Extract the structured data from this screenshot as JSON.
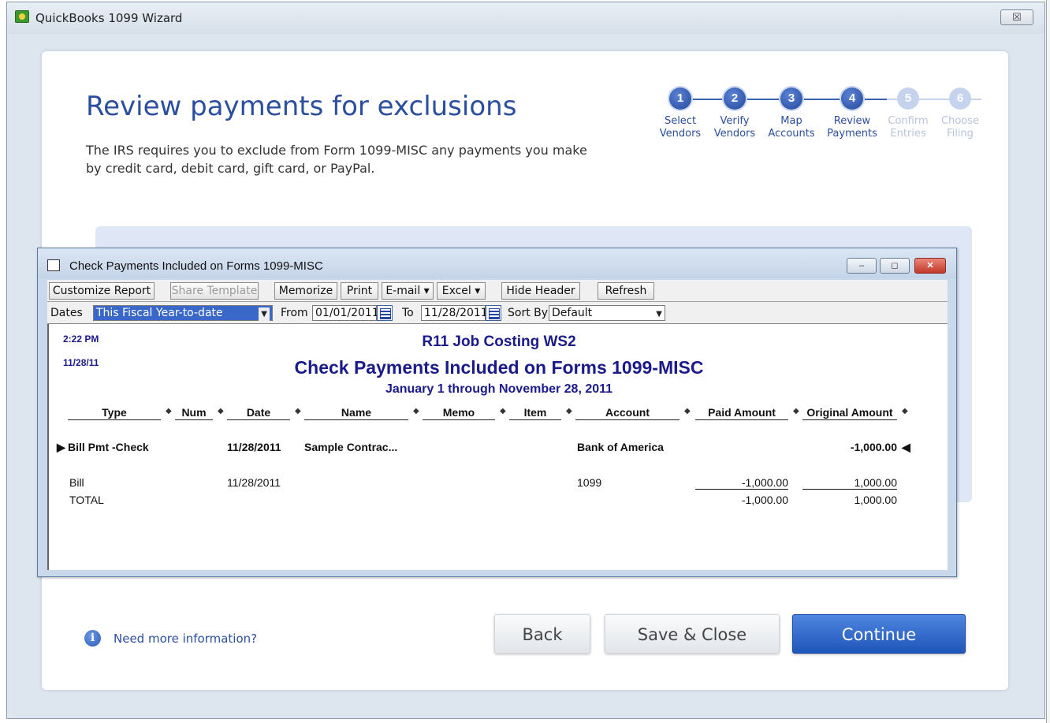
{
  "window": {
    "title": "QuickBooks 1099 Wizard",
    "close_glyph": "☒"
  },
  "page": {
    "title": "Review payments for exclusions",
    "description": "The IRS requires you to exclude from Form 1099-MISC any payments you make by credit card, debit card, gift card, or PayPal."
  },
  "steps": [
    {
      "num": "1",
      "line1": "Select",
      "line2": "Vendors",
      "state": "active"
    },
    {
      "num": "2",
      "line1": "Verify",
      "line2": "Vendors",
      "state": "active"
    },
    {
      "num": "3",
      "line1": "Map",
      "line2": "Accounts",
      "state": "active"
    },
    {
      "num": "4",
      "line1": "Review",
      "line2": "Payments",
      "state": "active"
    },
    {
      "num": "5",
      "line1": "Confirm",
      "line2": "Entries",
      "state": "inactive"
    },
    {
      "num": "6",
      "line1": "Choose",
      "line2": "Filing",
      "state": "inactive"
    }
  ],
  "report_window": {
    "title": "Check Payments Included on Forms 1099-MISC",
    "controls": {
      "minimize": "–",
      "restore": "◻",
      "close": "✕"
    },
    "toolbar": {
      "customize": "Customize Report",
      "share": "Share Template",
      "memorize": "Memorize",
      "print": "Print",
      "email": "E-mail ▾",
      "excel": "Excel ▾",
      "hide_header": "Hide Header",
      "refresh": "Refresh"
    },
    "filters": {
      "dates_label": "Dates",
      "dates_value": "This Fiscal Year-to-date",
      "from_label": "From",
      "from_value": "01/01/2011",
      "to_label": "To",
      "to_value": "11/28/2011",
      "sortby_label": "Sort By",
      "sortby_value": "Default"
    },
    "report": {
      "time": "2:22 PM",
      "date": "11/28/11",
      "company": "R11 Job Costing WS2",
      "title": "Check Payments Included on Forms 1099-MISC",
      "subtitle": "January 1 through November 28, 2011",
      "columns": [
        "Type",
        "Num",
        "Date",
        "Name",
        "Memo",
        "Item",
        "Account",
        "Paid Amount",
        "Original Amount"
      ],
      "group_row": {
        "type": "Bill Pmt -Check",
        "date": "11/28/2011",
        "name": "Sample Contrac...",
        "account": "Bank of America",
        "original": "-1,000.00"
      },
      "detail_row": {
        "type": "Bill",
        "date": "11/28/2011",
        "account": "1099",
        "paid": "-1,000.00",
        "original": "1,000.00"
      },
      "total_row": {
        "label": "TOTAL",
        "paid": "-1,000.00",
        "original": "1,000.00"
      }
    }
  },
  "footer": {
    "help_icon": "i",
    "help_text": "Need more information?",
    "back": "Back",
    "save_close": "Save & Close",
    "continue": "Continue"
  }
}
